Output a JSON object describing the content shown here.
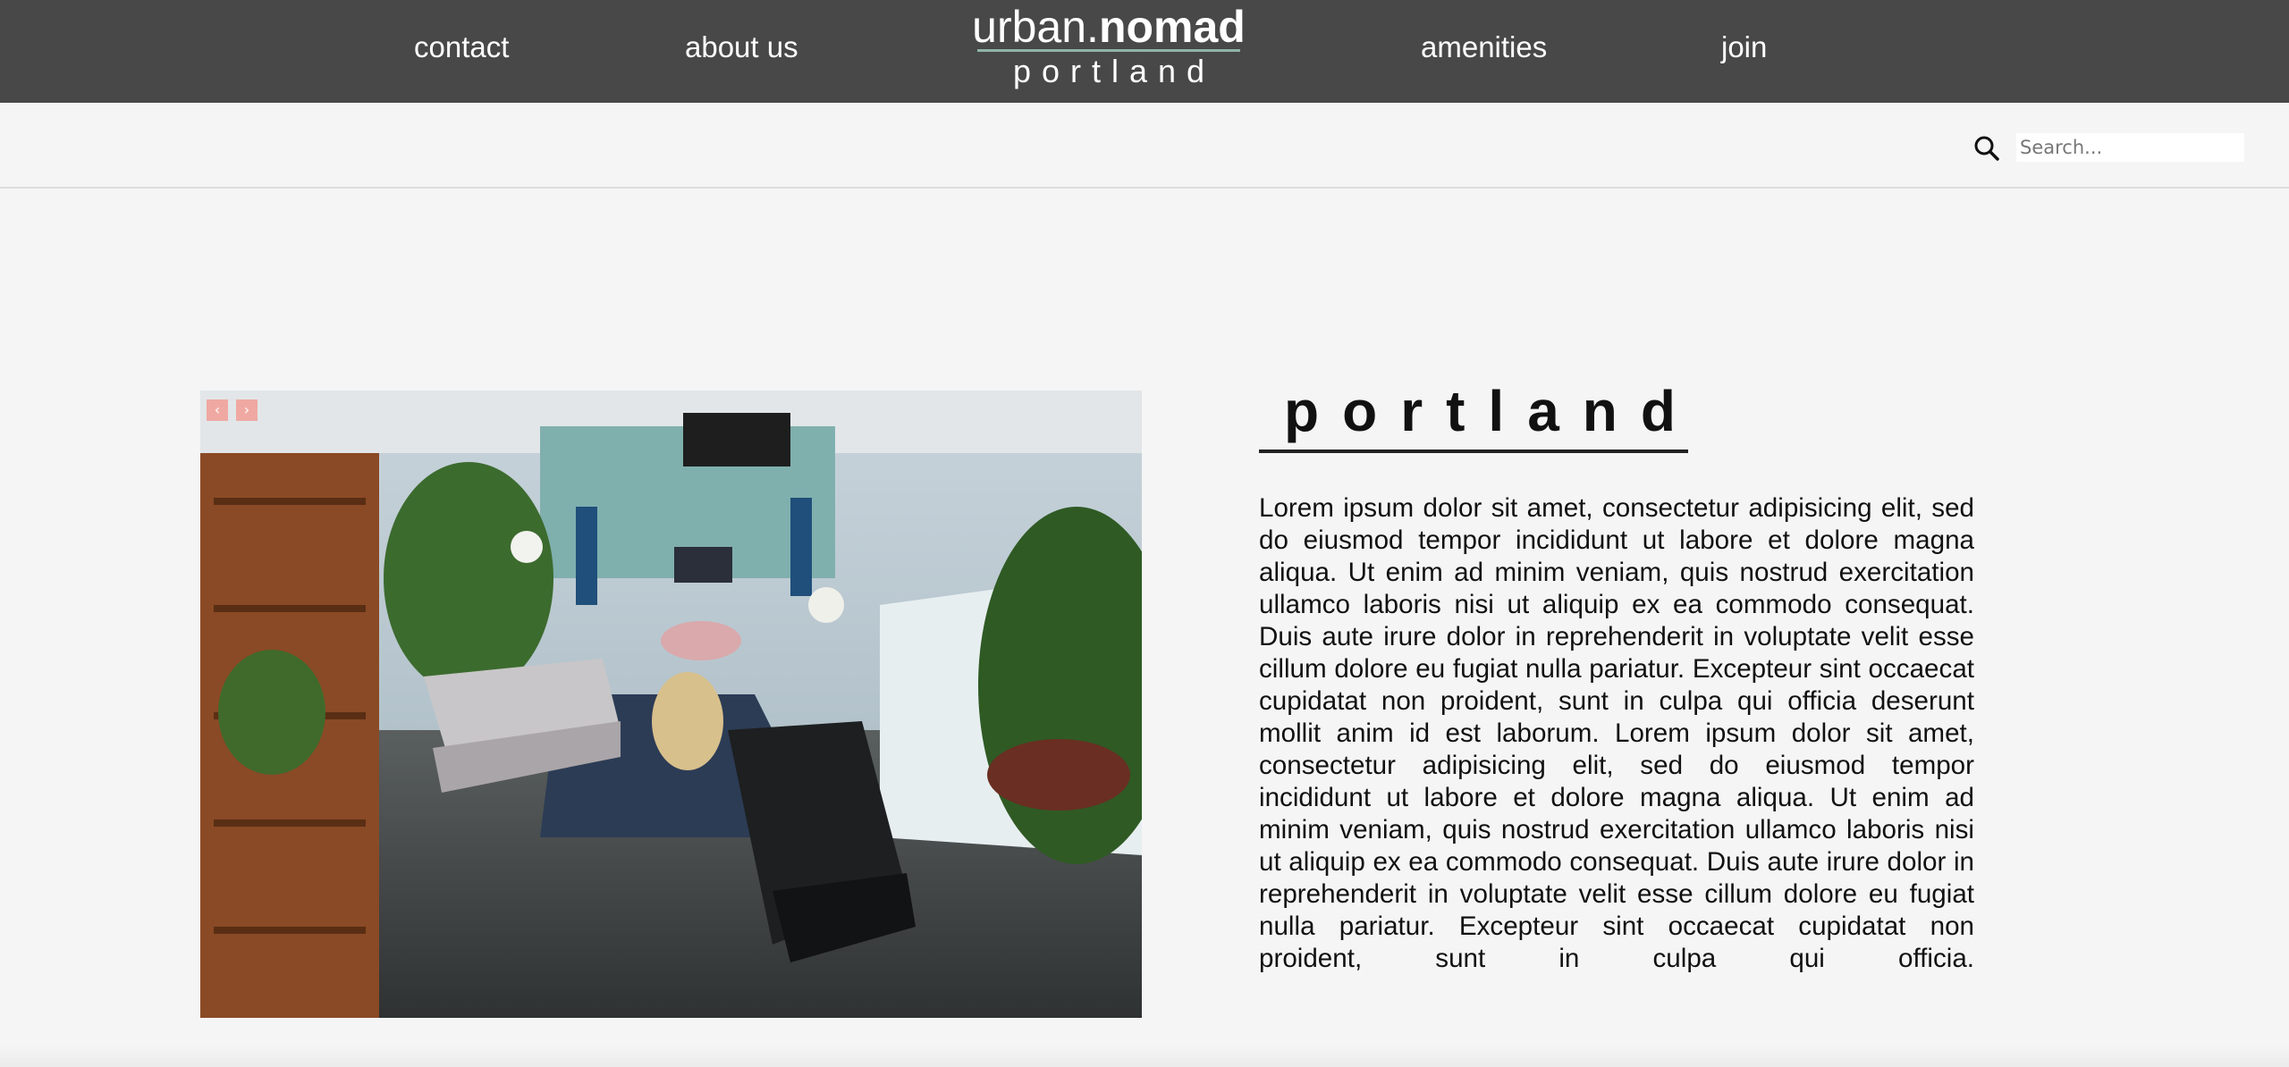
{
  "nav": {
    "items": [
      {
        "label": "contact"
      },
      {
        "label": "about us"
      },
      {
        "label": "amenities"
      },
      {
        "label": "join"
      }
    ],
    "logo": {
      "part1": "urban.",
      "part2": "nomad",
      "city": "portland"
    }
  },
  "search": {
    "placeholder": "Search...",
    "value": "",
    "icon": "search-icon"
  },
  "gallery": {
    "prev_label": "‹",
    "next_label": "›",
    "image_description_icon": "lounge-photo"
  },
  "content": {
    "title": "portland",
    "body": "Lorem ipsum dolor sit amet, consectetur adipisicing elit, sed do eiusmod tempor incididunt ut labore et dolore magna aliqua. Ut enim ad minim veniam, quis nostrud exercitation ullamco laboris nisi ut aliquip ex ea commodo consequat. Duis aute irure dolor in reprehenderit in voluptate velit esse cillum dolore eu fugiat nulla pariatur. Excepteur sint occaecat cupidatat non proident, sunt in culpa qui officia deserunt mollit anim id est laborum. Lorem ipsum dolor sit amet, consectetur adipisicing elit, sed do eiusmod tempor incididunt ut labore et dolore magna aliqua. Ut enim ad minim veniam, quis nostrud exercitation ullamco laboris nisi ut aliquip ex ea commodo consequat. Duis aute irure dolor in reprehenderit in voluptate velit esse cillum dolore eu fugiat nulla pariatur. Excepteur sint occaecat cupidatat non proident, sunt in culpa qui officia."
  },
  "colors": {
    "nav_bg": "#484848",
    "page_bg": "#f5f5f5",
    "slider_button": "#f1a39b",
    "logo_rule": "#8fb3a8"
  }
}
